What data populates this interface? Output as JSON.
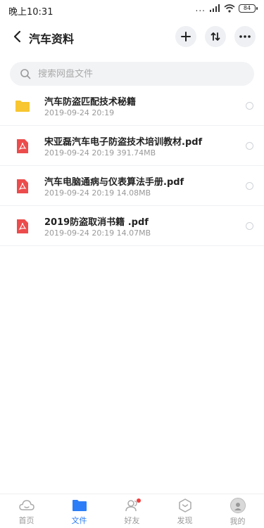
{
  "status": {
    "time": "晚上10:31",
    "signal_dots": "...",
    "battery": "84"
  },
  "header": {
    "title": "汽车资料"
  },
  "search": {
    "placeholder": "搜索网盘文件"
  },
  "files": [
    {
      "name": "汽车防盗匹配技术秘籍",
      "meta": "2019-09-24  20:19",
      "icon": "folder-icon"
    },
    {
      "name": "宋亚磊汽车电子防盗技术培训教材.pdf",
      "meta": "2019-09-24  20:19   391.74MB",
      "icon": "pdf-icon"
    },
    {
      "name": "汽车电脑通病与仪表算法手册.pdf",
      "meta": "2019-09-24  20:19   14.08MB",
      "icon": "pdf-icon"
    },
    {
      "name": "2019防盗取消书籍 .pdf",
      "meta": "2019-09-24  20:19   14.07MB",
      "icon": "pdf-icon"
    }
  ],
  "tabs": [
    {
      "label": "首页",
      "icon": "home-cloud-icon"
    },
    {
      "label": "文件",
      "icon": "folder-icon"
    },
    {
      "label": "好友",
      "icon": "friends-icon"
    },
    {
      "label": "发现",
      "icon": "discover-icon"
    },
    {
      "label": "我的",
      "icon": "avatar"
    }
  ],
  "colors": {
    "accent": "#2b7ef7",
    "folder": "#f7c630",
    "pdf": "#ec4c4c",
    "badge": "#f23c3c"
  }
}
